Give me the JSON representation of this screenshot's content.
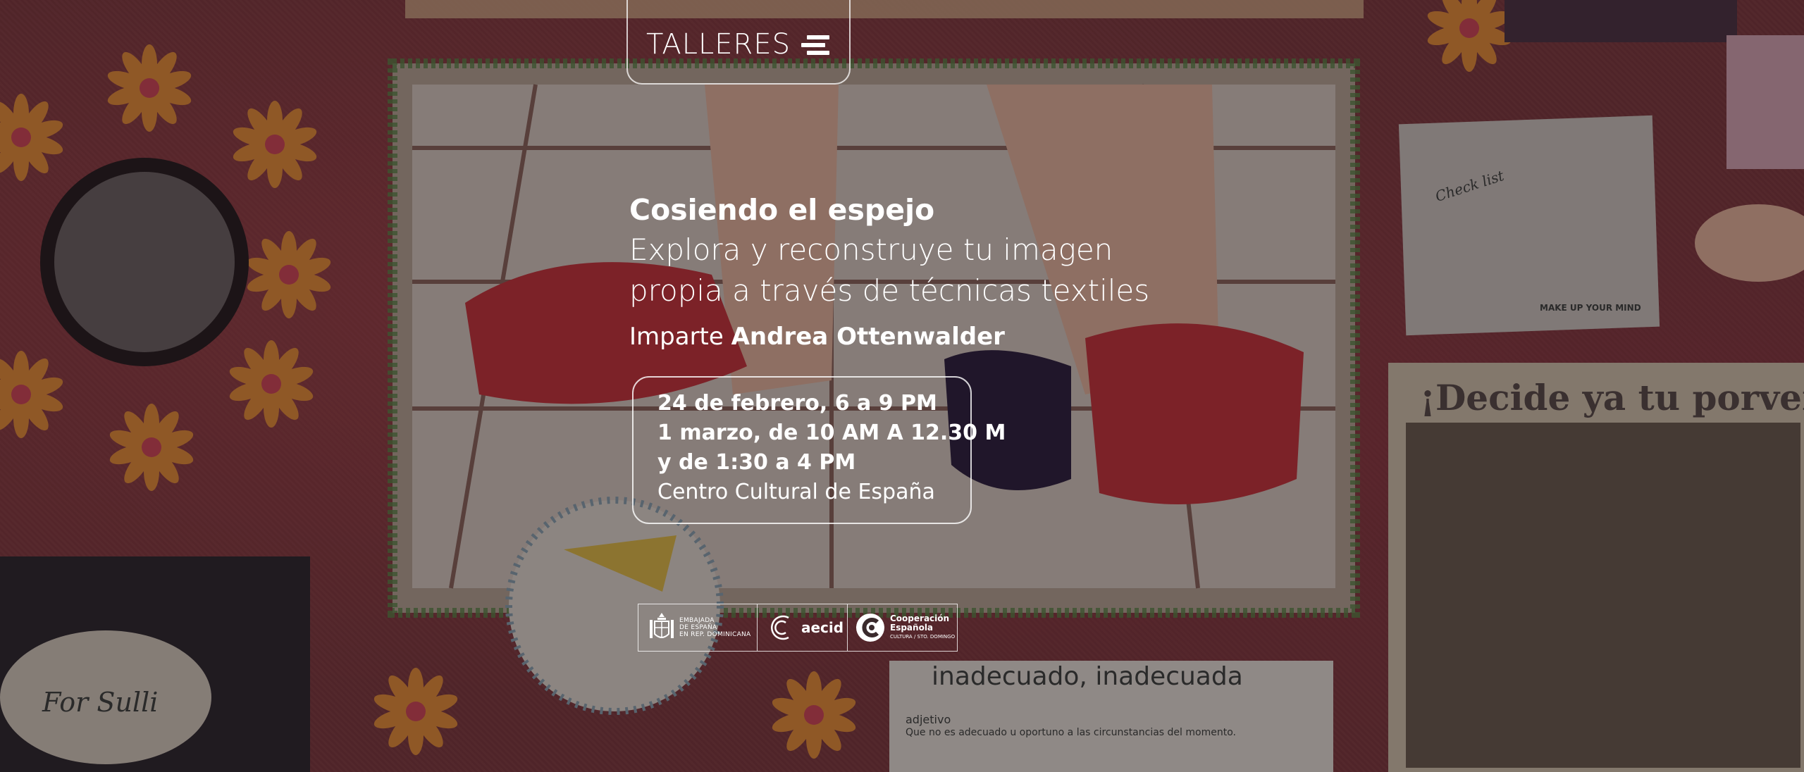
{
  "nav": {
    "tab_label": "TALLERES",
    "menu_icon": "stacked-lines-icon"
  },
  "event": {
    "title": "Cosiendo el espejo",
    "subtitle_line1": "Explora y reconstruye tu imagen",
    "subtitle_line2": "propia a través de técnicas textiles",
    "instructor_prefix": "Imparte",
    "instructor_name": "Andrea Ottenwalder"
  },
  "schedule": {
    "line1": "24 de febrero, 6 a 9 PM",
    "line2": "1 marzo, de 10 AM A 12.30 M",
    "line3": "y de 1:30 a 4 PM",
    "venue": "Centro Cultural de España"
  },
  "logos": {
    "embassy_line1": "EMBAJADA",
    "embassy_line2": "DE ESPAÑA",
    "embassy_line3": "EN REP. DOMINICANA",
    "aecid": "aecid",
    "coop_line1": "Cooperación",
    "coop_line2": "Española",
    "coop_line3": "CULTURA / STO. DOMINGO"
  },
  "artwork": {
    "poster_headline": "¡Decide ya tu porven",
    "dictionary_word": "inadecuado, inadecuada",
    "dictionary_pos": "adjetivo",
    "dictionary_def": "Que no es adecuado u oportuno a las circunstancias del momento.",
    "checklist_title": "Check list",
    "checklist_caption": "MAKE UP YOUR MIND",
    "cake_text": "For Sulli"
  },
  "colors": {
    "fabric": "#7e3a40",
    "flower": "#e08a2c",
    "overlay": "#140a0c",
    "text": "#ffffff"
  }
}
